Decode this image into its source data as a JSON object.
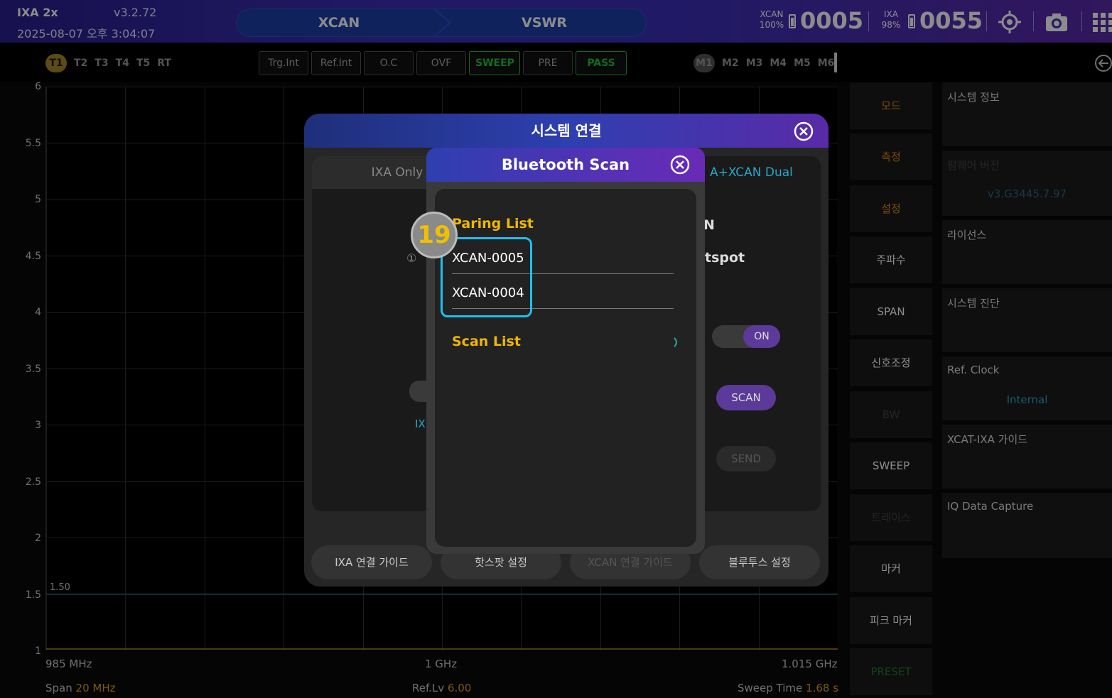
{
  "topbar": {
    "app_name": "IXA 2x",
    "version": "v3.2.72",
    "datetime": "2025-08-07 오후 3:04:07",
    "mode_left": "XCAN",
    "mode_right": "VSWR",
    "xcan_label": "XCAN",
    "xcan_battery": "100%",
    "xcan_id": "0005",
    "ixa_label": "IXA",
    "ixa_battery": "98%",
    "ixa_id": "0055",
    "icons": [
      "gps-target-icon",
      "camera-icon",
      "grid-menu-icon"
    ]
  },
  "trace_tabs": [
    "T1",
    "T2",
    "T3",
    "T4",
    "T5",
    "RT"
  ],
  "status_buttons": [
    "Trg.Int",
    "Ref.Int",
    "O.C",
    "OVF",
    "SWEEP",
    "PRE",
    "PASS"
  ],
  "marker_tabs": [
    "M1",
    "M2",
    "M3",
    "M4",
    "M5",
    "M6"
  ],
  "plot": {
    "y_ticks": [
      "6",
      "5.5",
      "5",
      "4.5",
      "4",
      "3.5",
      "3",
      "2.5",
      "2",
      "1.5",
      "1"
    ],
    "ylim": [
      1,
      6
    ],
    "limit_line_value": 1.5,
    "limit_line_label": "1.50",
    "x_start": "985 MHz",
    "x_center": "1 GHz",
    "x_end": "1.015 GHz",
    "span_label": "Span",
    "span_value": "20 MHz",
    "reflv_label": "Ref.Lv",
    "reflv_value": "6.00",
    "sweep_label": "Sweep Time",
    "sweep_value": "1.68 s"
  },
  "menu": [
    "모드",
    "측정",
    "설정",
    "주파수",
    "SPAN",
    "신호조정",
    "BW",
    "SWEEP",
    "트레이스",
    "마커",
    "피크 마커",
    "PRESET"
  ],
  "info_panels": {
    "system_info": "시스템 정보",
    "firmware_label": "펌웨어 버전",
    "firmware_value": "v3.G3445.7.97",
    "license": "라이선스",
    "diagnosis": "시스템 진단",
    "ref_clock_label": "Ref. Clock",
    "ref_clock_value": "Internal",
    "guide": "XCAT-IXA 가이드",
    "iq_capture": "IQ Data Capture"
  },
  "system_dialog": {
    "title": "시스템 연결",
    "tab_ixa_only": "IXA Only",
    "tab_dual": "A+XCAN Dual",
    "frag_n": "N",
    "frag_hotspot": "tspot",
    "frag_circle1": "①",
    "frag_ix": "IX",
    "toggle_on": "ON",
    "scan_btn": "SCAN",
    "send_btn": "SEND",
    "btn_ixa_guide": "IXA 연결 가이드",
    "btn_hotspot": "핫스팟 설정",
    "btn_xcan_guide": "XCAN 연결 가이드",
    "btn_bluetooth": "블루투스 설정"
  },
  "bluetooth_dialog": {
    "title": "Bluetooth Scan",
    "pairing_header": "Paring List",
    "paired_devices": [
      "XCAN-0005",
      "XCAN-0004"
    ],
    "scan_header": "Scan List"
  },
  "annotation": {
    "step_number": "19"
  }
}
